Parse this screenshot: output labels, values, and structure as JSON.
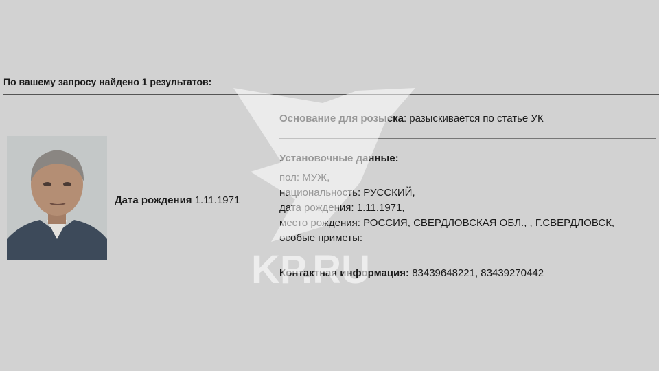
{
  "summary": "По вашему запросу найдено 1 результатов:",
  "person": {
    "dob_label": "Дата рождения",
    "dob_value": "1.11.1971"
  },
  "basis": {
    "label": "Основание для розыска",
    "value": ": разыскивается по статье УК"
  },
  "identity": {
    "header": "Установочные данные:",
    "gender": "пол: МУЖ,",
    "nationality": "национальность: РУССКИЙ,",
    "birth_date": "дата рождения: 1.11.1971,",
    "birth_place": "место рождения: РОССИЯ, СВЕРДЛОВСКАЯ ОБЛ., , Г.СВЕРДЛОВСК,",
    "features": "особые приметы:"
  },
  "contact": {
    "label": "Контактная информация:",
    "value": "83439648221, 83439270442"
  },
  "watermark": {
    "text": "KP.RU"
  }
}
